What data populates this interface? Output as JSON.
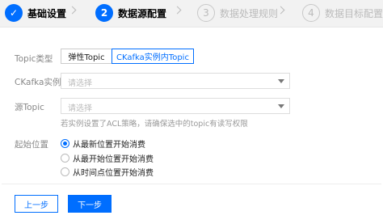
{
  "stepper": {
    "steps": [
      {
        "number": "✓",
        "label": "基础设置",
        "state": "done"
      },
      {
        "number": "2",
        "label": "数据源配置",
        "state": "active"
      },
      {
        "number": "3",
        "label": "数据处理规则",
        "state": "todo"
      },
      {
        "number": "4",
        "label": "数据目标配置",
        "state": "todo"
      }
    ]
  },
  "form": {
    "topic_type": {
      "label": "Topic类型",
      "options": [
        "弹性Topic",
        "CKafka实例内Topic"
      ],
      "selected": "CKafka实例内Topic"
    },
    "ckafka_instance": {
      "label": "CKafka实例",
      "placeholder": "请选择"
    },
    "source_topic": {
      "label": "源Topic",
      "placeholder": "请选择"
    },
    "hint": "若实例设置了ACL策略，请确保选中的topic有读写权限",
    "start_position": {
      "label": "起始位置",
      "options": [
        "从最新位置开始消费",
        "从最开始位置开始消费",
        "从时间点位置开始消费"
      ],
      "selected": "从最新位置开始消费"
    }
  },
  "actions": {
    "prev_label": "上一步",
    "next_label": "下一步"
  },
  "colors": {
    "accent": "#006eff",
    "stepper_bg": "#f2f2f2"
  }
}
